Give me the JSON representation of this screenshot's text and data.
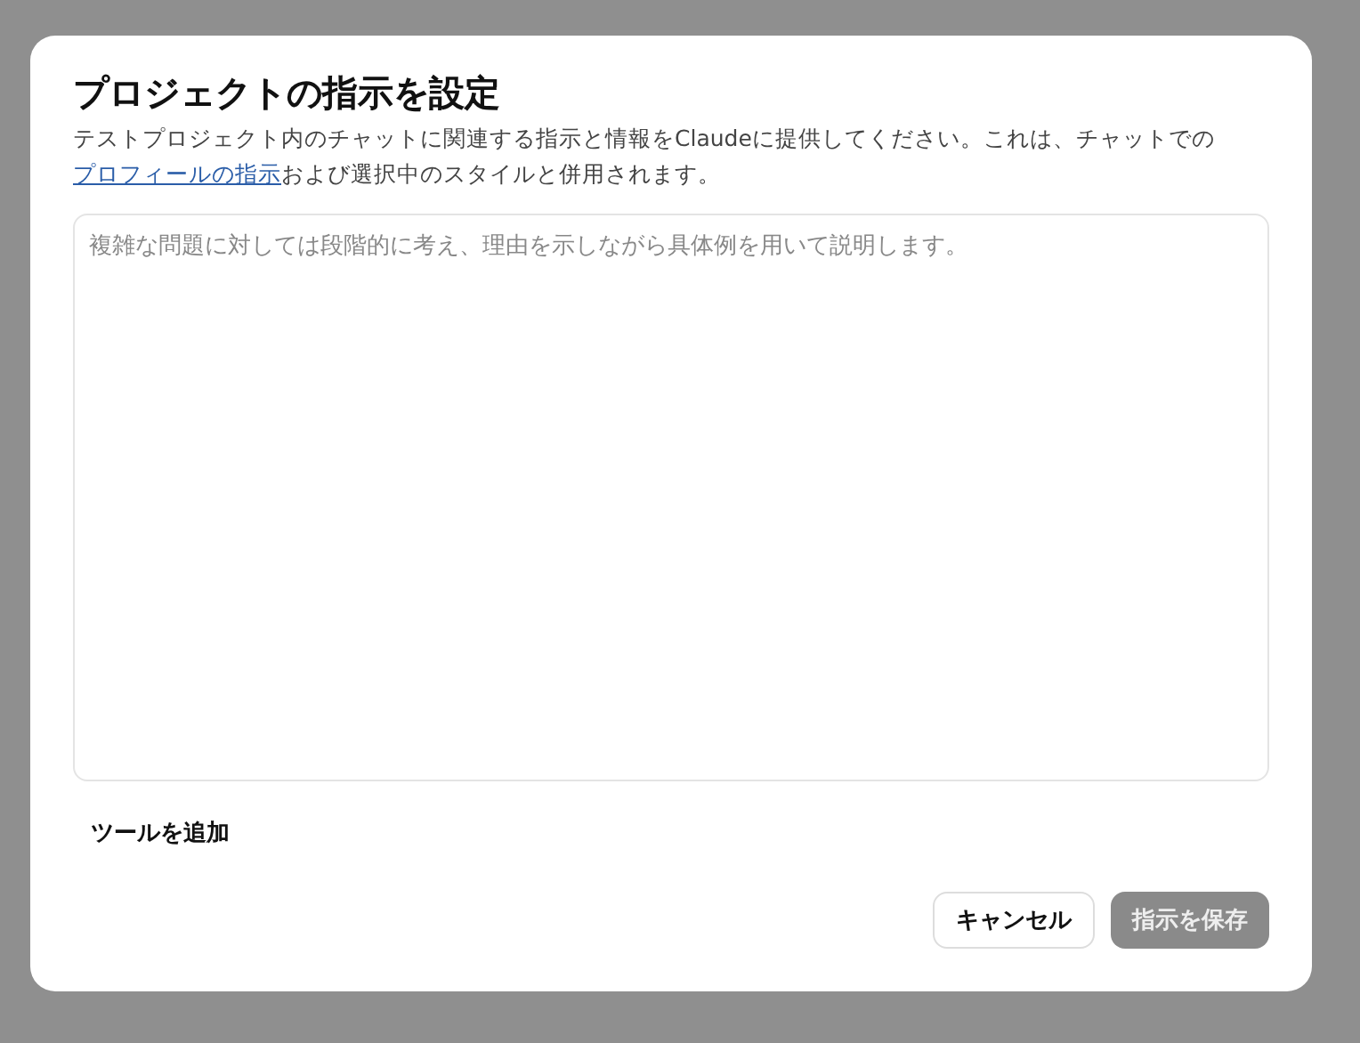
{
  "dialog": {
    "title": "プロジェクトの指示を設定",
    "description": {
      "before": "テストプロジェクト内のチャットに関連する指示と情報をClaudeに提供してください。これは、チャットでの",
      "link": "プロフィールの指示",
      "after": "および選択中のスタイルと併用されます。"
    },
    "instructions": {
      "placeholder": "複雑な問題に対しては段階的に考え、理由を示しながら具体例を用いて説明します。"
    },
    "add_tools": "ツールを追加",
    "buttons": [
      {
        "label": "キャンセル",
        "kind": "secondary",
        "disabled": false
      },
      {
        "label": "指示を保存",
        "kind": "primary",
        "disabled": true
      }
    ]
  }
}
